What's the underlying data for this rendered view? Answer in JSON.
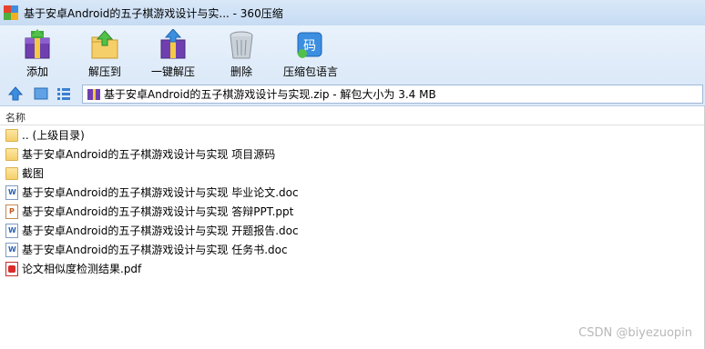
{
  "window": {
    "title": "基于安卓Android的五子棋游戏设计与实...  - 360压缩"
  },
  "toolbar": {
    "items": [
      {
        "label": "添加",
        "icon": "add-archive-icon"
      },
      {
        "label": "解压到",
        "icon": "extract-to-icon"
      },
      {
        "label": "一键解压",
        "icon": "one-click-extract-icon"
      },
      {
        "label": "删除",
        "icon": "delete-trash-icon"
      },
      {
        "label": "压缩包语言",
        "icon": "archive-language-icon"
      }
    ]
  },
  "address": {
    "path": "基于安卓Android的五子棋游戏设计与实现.zip - 解包大小为 3.4 MB"
  },
  "list": {
    "column_name": "名称",
    "items": [
      {
        "name": ".. (上级目录)",
        "type": "folder"
      },
      {
        "name": "基于安卓Android的五子棋游戏设计与实现 项目源码",
        "type": "folder"
      },
      {
        "name": "截图",
        "type": "folder"
      },
      {
        "name": "基于安卓Android的五子棋游戏设计与实现 毕业论文.doc",
        "type": "doc"
      },
      {
        "name": "基于安卓Android的五子棋游戏设计与实现 答辩PPT.ppt",
        "type": "ppt"
      },
      {
        "name": "基于安卓Android的五子棋游戏设计与实现 开题报告.doc",
        "type": "doc"
      },
      {
        "name": "基于安卓Android的五子棋游戏设计与实现 任务书.doc",
        "type": "doc"
      },
      {
        "name": "论文相似度检测结果.pdf",
        "type": "pdf"
      }
    ]
  },
  "watermark": "CSDN @biyezuopin",
  "colors": {
    "titlebar": "#c6dbf3",
    "toolbar": "#dce9f8",
    "folder": "#f5cf6a",
    "accent": "#2b6fc9"
  }
}
